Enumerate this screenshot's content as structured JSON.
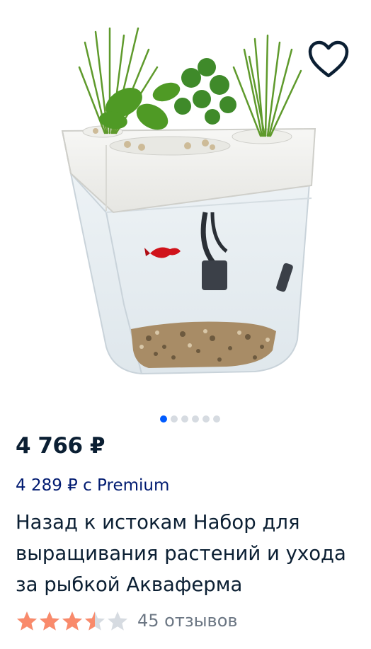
{
  "product": {
    "price": "4 766 ₽",
    "premium_price": "4 289 ₽ с Premium",
    "title": "Назад к истокам Набор для выращивания растений и ухода за рыбкой Акваферма",
    "rating": 3.5,
    "rating_max": 5,
    "reviews": "45 отзывов"
  },
  "carousel": {
    "count": 6,
    "active_index": 0
  },
  "colors": {
    "accent": "#005bff",
    "star": "#f98a6b",
    "star_empty": "#d6dbe1",
    "premium": "#001a70"
  },
  "icons": {
    "favorite": "heart-outline-icon",
    "star": "star-icon"
  }
}
